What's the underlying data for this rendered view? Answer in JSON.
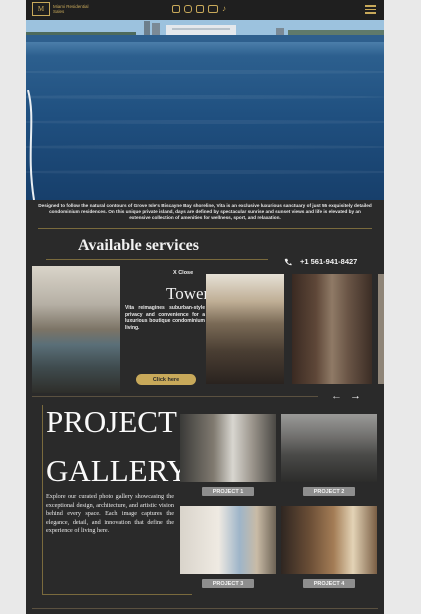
{
  "header": {
    "logo_mark": "M",
    "logo_text": "Miami Residential Sales",
    "social_icons": [
      "facebook-icon",
      "instagram-icon",
      "linkedin-icon",
      "youtube-icon",
      "tiktok-icon"
    ],
    "menu_icon": "hamburger-menu-icon"
  },
  "intro": {
    "text": "Designed to follow the natural contours of Grove Isle's Biscayne Bay shoreline, Vita is an exclusive luxurious sanctuary of just 55 exquisitely detailed condominium residences. On this unique private island, days are defined by spectacular sunrise and sunset views and life is elevated by an extensive collection of amenities for wellness, sport, and relaxation."
  },
  "services": {
    "title": "Available services",
    "phone": "+1 561-941-8427",
    "close_label": "X  Close",
    "card_title": "Tower",
    "card_description": "Vita reimagines suburban-style privacy and convenience for a luxurious boutique condominium living.",
    "cta_label": "Click here",
    "prev_arrow": "←",
    "next_arrow": "→"
  },
  "gallery": {
    "title_line1": "PROJECT",
    "title_line2": "GALLERY",
    "description": "Explore our curated photo gallery showcasing the exceptional design, architecture, and artistic vision behind every space. Each image captures the elegance, detail, and innovation that define the experience of living here.",
    "projects": [
      {
        "label": "PROJECT 1"
      },
      {
        "label": "PROJECT 2"
      },
      {
        "label": "PROJECT 3"
      },
      {
        "label": "PROJECT 4"
      }
    ]
  },
  "colors": {
    "accent": "#c8a95a",
    "background": "#2a2a2a",
    "button_gray": "#8e8e8e"
  }
}
